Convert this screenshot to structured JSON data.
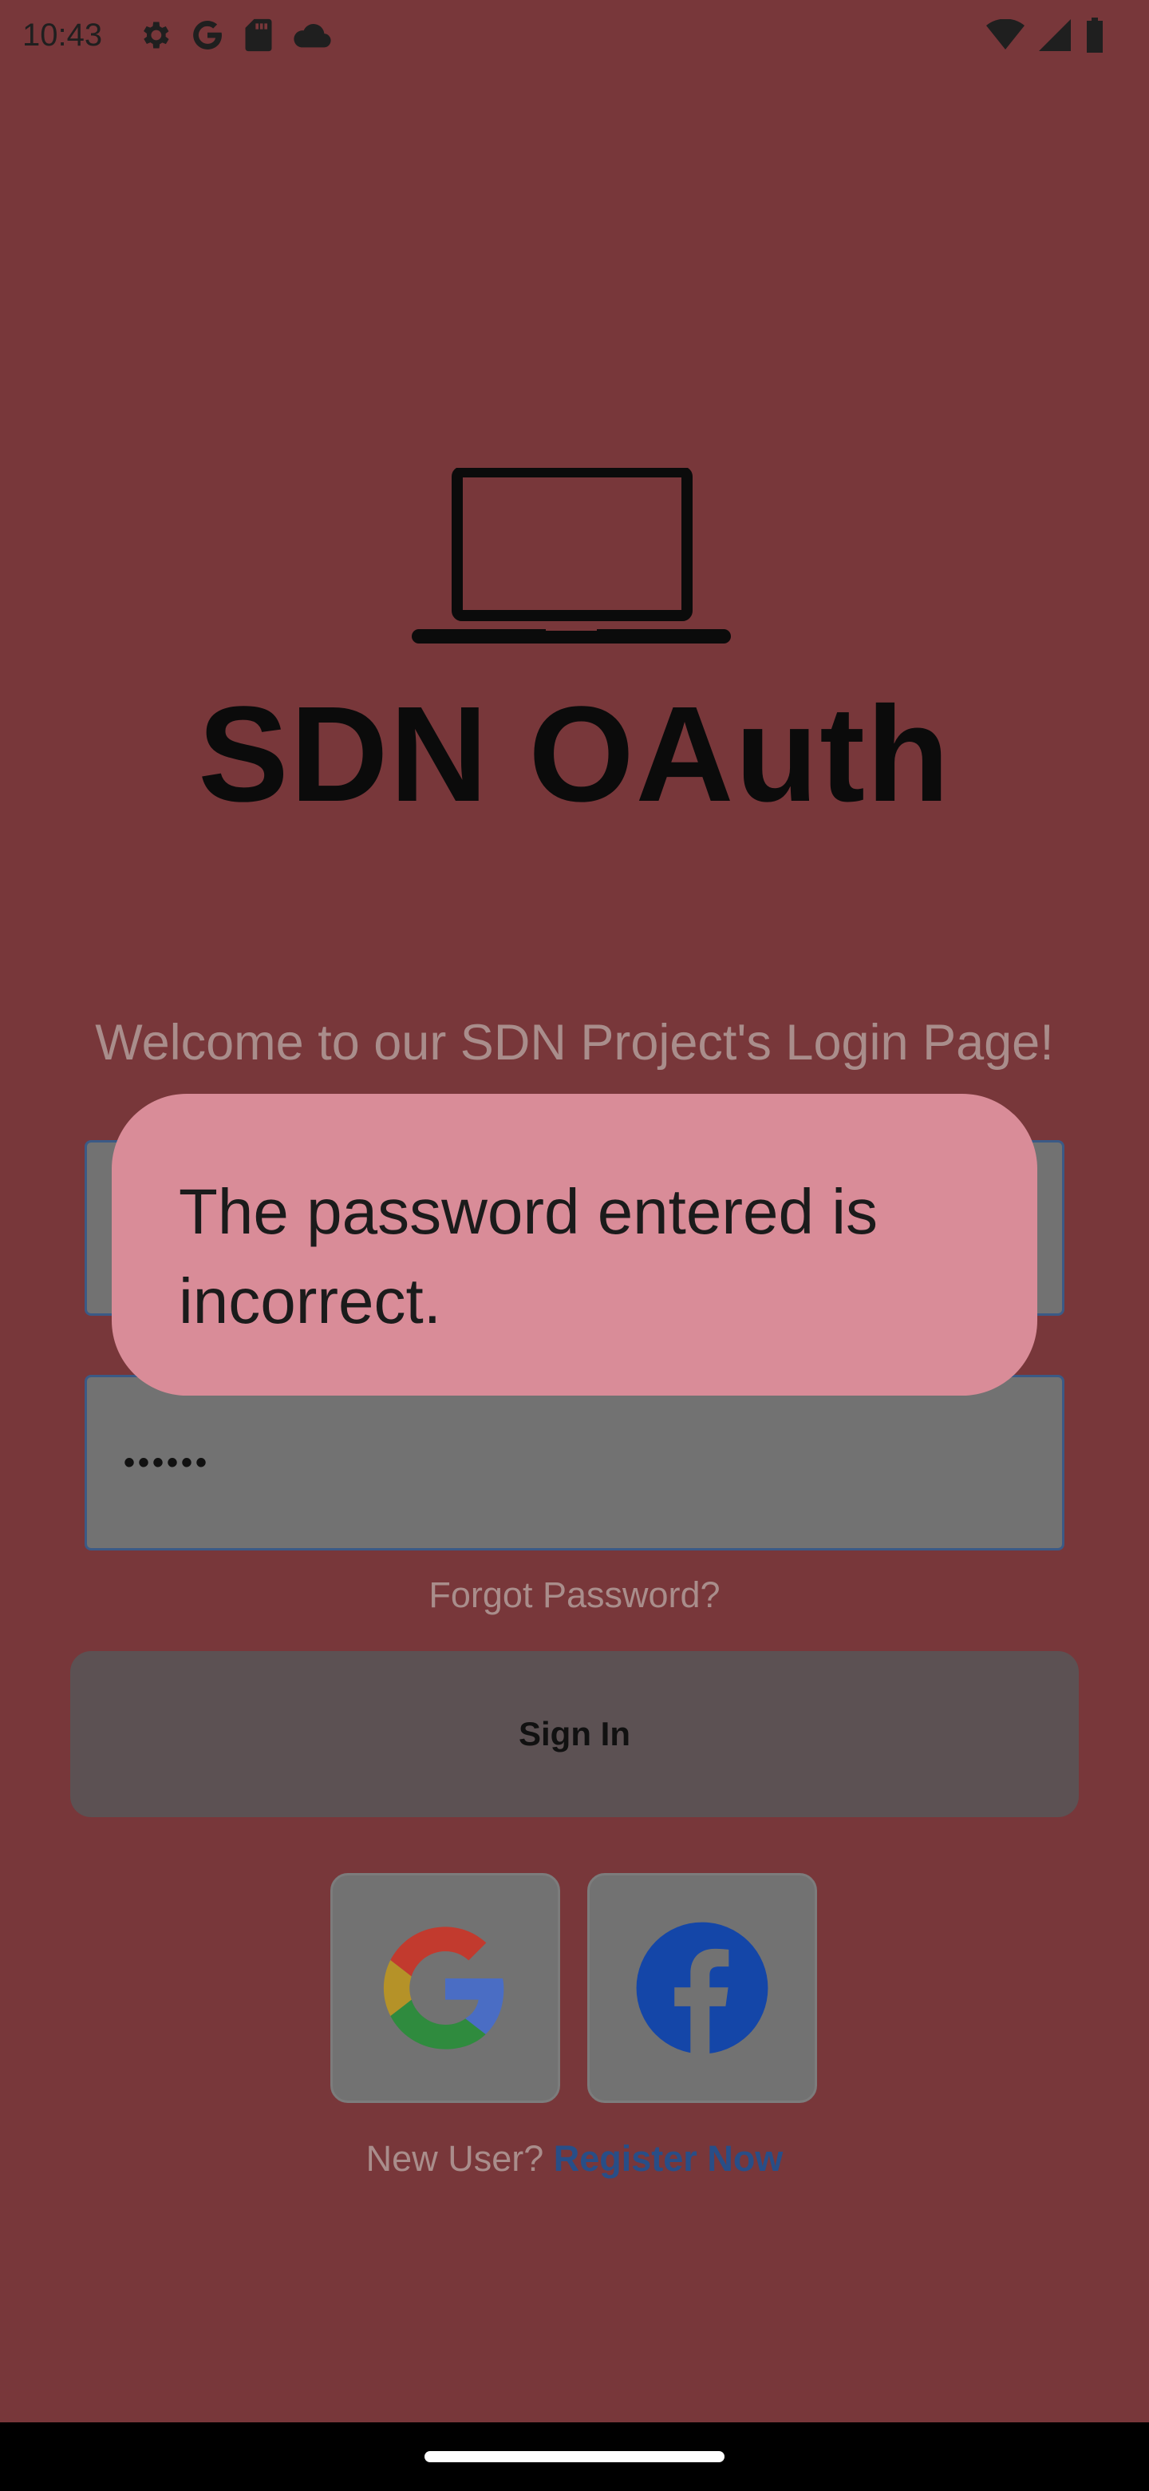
{
  "status_bar": {
    "time": "10:43",
    "left_icons": [
      "settings-icon",
      "google-icon",
      "sd-card-icon",
      "cloud-icon"
    ],
    "right_icons": [
      "wifi-icon",
      "signal-icon",
      "battery-icon"
    ]
  },
  "logo": {
    "icon": "laptop-icon",
    "title": "SDN OAuth"
  },
  "welcome_text": "Welcome to our SDN Project's Login Page!",
  "form": {
    "username_value": "",
    "password_value": "••••••",
    "forgot_password_label": "Forgot Password?",
    "sign_in_label": "Sign In"
  },
  "social": {
    "google_icon": "google-logo-icon",
    "facebook_icon": "facebook-logo-icon"
  },
  "register": {
    "prompt": "New User?",
    "link_label": "Register Now"
  },
  "toast": {
    "message": "The password entered is incorrect."
  },
  "colors": {
    "background_scrim": "#78373a",
    "toast_background": "#d98c98",
    "link": "#284e87"
  }
}
